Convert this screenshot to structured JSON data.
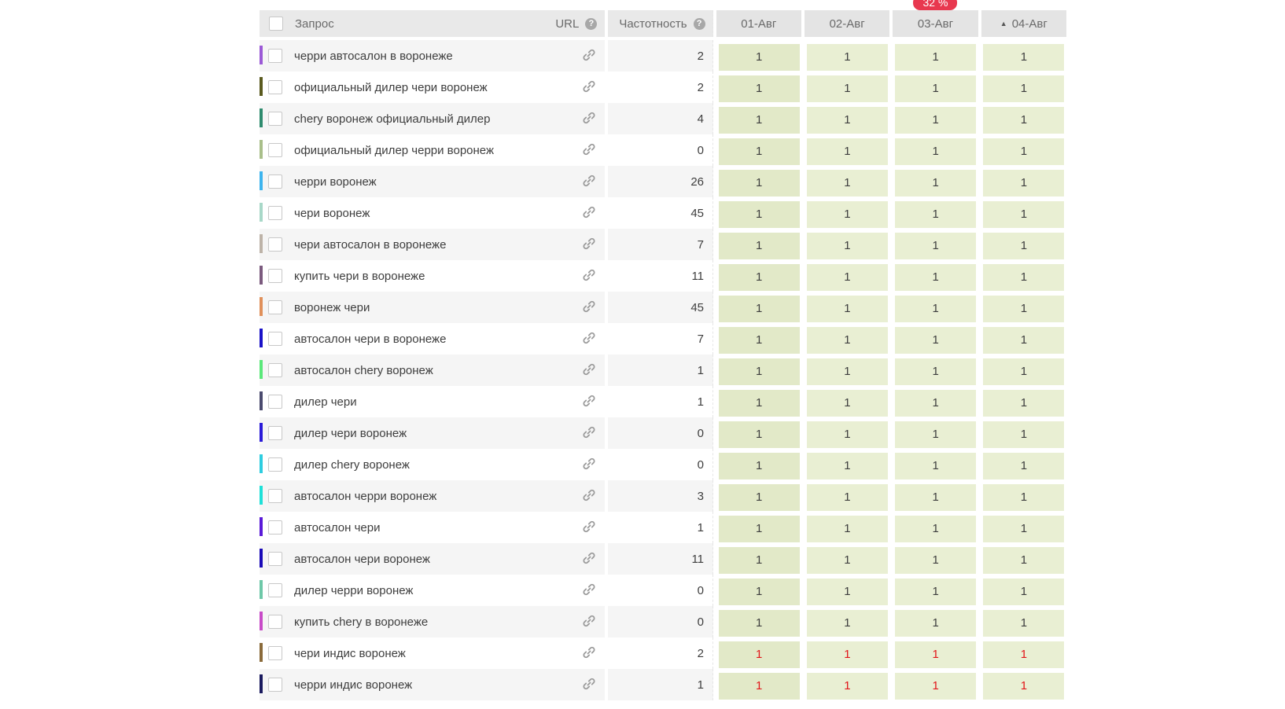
{
  "header": {
    "query_label": "Запрос",
    "url_label": "URL",
    "freq_label": "Частотность",
    "help_glyph": "?",
    "days": [
      "01-Авг",
      "02-Авг",
      "03-Авг",
      "04-Авг"
    ],
    "badge": "32 %",
    "sort_glyph": "▲"
  },
  "rows": [
    {
      "query": "черри автосалон в воронеже",
      "freq": "2",
      "color": "#9b59d6",
      "pos": [
        "1",
        "1",
        "1",
        "1"
      ],
      "red": false
    },
    {
      "query": "официальный дилер чери воронеж",
      "freq": "2",
      "color": "#5a5a1e",
      "pos": [
        "1",
        "1",
        "1",
        "1"
      ],
      "red": false
    },
    {
      "query": "chery воронеж официальный дилер",
      "freq": "4",
      "color": "#2e8b6e",
      "pos": [
        "1",
        "1",
        "1",
        "1"
      ],
      "red": false
    },
    {
      "query": "официальный дилер черри воронеж",
      "freq": "0",
      "color": "#a9bf8a",
      "pos": [
        "1",
        "1",
        "1",
        "1"
      ],
      "red": false
    },
    {
      "query": "черри воронеж",
      "freq": "26",
      "color": "#3db4ee",
      "pos": [
        "1",
        "1",
        "1",
        "1"
      ],
      "red": false
    },
    {
      "query": "чери воронеж",
      "freq": "45",
      "color": "#a8d8c8",
      "pos": [
        "1",
        "1",
        "1",
        "1"
      ],
      "red": false
    },
    {
      "query": "чери автосалон в воронеже",
      "freq": "7",
      "color": "#bdb3a8",
      "pos": [
        "1",
        "1",
        "1",
        "1"
      ],
      "red": false
    },
    {
      "query": "купить чери в воронеже",
      "freq": "11",
      "color": "#7b5a7e",
      "pos": [
        "1",
        "1",
        "1",
        "1"
      ],
      "red": false
    },
    {
      "query": "воронеж чери",
      "freq": "45",
      "color": "#e0905a",
      "pos": [
        "1",
        "1",
        "1",
        "1"
      ],
      "red": false
    },
    {
      "query": "автосалон чери в воронеже",
      "freq": "7",
      "color": "#1a12c8",
      "pos": [
        "1",
        "1",
        "1",
        "1"
      ],
      "red": false
    },
    {
      "query": "автосалон chery воронеж",
      "freq": "1",
      "color": "#5ae87a",
      "pos": [
        "1",
        "1",
        "1",
        "1"
      ],
      "red": false
    },
    {
      "query": "дилер чери",
      "freq": "1",
      "color": "#4a4a6e",
      "pos": [
        "1",
        "1",
        "1",
        "1"
      ],
      "red": false
    },
    {
      "query": "дилер чери воронеж",
      "freq": "0",
      "color": "#2a1ad8",
      "pos": [
        "1",
        "1",
        "1",
        "1"
      ],
      "red": false
    },
    {
      "query": "дилер chery воронеж",
      "freq": "0",
      "color": "#2ecde0",
      "pos": [
        "1",
        "1",
        "1",
        "1"
      ],
      "red": false
    },
    {
      "query": "автосалон черри воронеж",
      "freq": "3",
      "color": "#1ee0d8",
      "pos": [
        "1",
        "1",
        "1",
        "1"
      ],
      "red": false
    },
    {
      "query": "автосалон чери",
      "freq": "1",
      "color": "#5a1ad8",
      "pos": [
        "1",
        "1",
        "1",
        "1"
      ],
      "red": false
    },
    {
      "query": "автосалон чери воронеж",
      "freq": "11",
      "color": "#1a0ab8",
      "pos": [
        "1",
        "1",
        "1",
        "1"
      ],
      "red": false
    },
    {
      "query": "дилер черри воронеж",
      "freq": "0",
      "color": "#6ec8a8",
      "pos": [
        "1",
        "1",
        "1",
        "1"
      ],
      "red": false
    },
    {
      "query": "купить chery в воронеже",
      "freq": "0",
      "color": "#c84ac8",
      "pos": [
        "1",
        "1",
        "1",
        "1"
      ],
      "red": false
    },
    {
      "query": "чери индис воронеж",
      "freq": "2",
      "color": "#8a6a3a",
      "pos": [
        "1",
        "1",
        "1",
        "1"
      ],
      "red": true
    },
    {
      "query": "черри индис воронеж",
      "freq": "1",
      "color": "#1a1a5e",
      "pos": [
        "1",
        "1",
        "1",
        "1"
      ],
      "red": true
    }
  ]
}
